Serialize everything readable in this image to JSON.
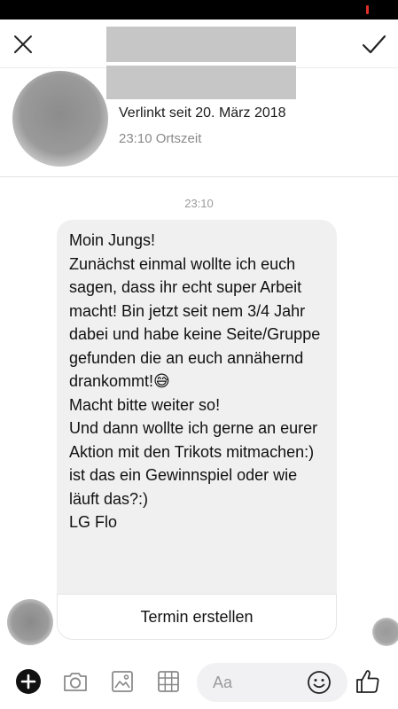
{
  "header": {
    "linked_text": "Verlinkt seit 20. März 2018",
    "local_time": "23:10 Ortszeit"
  },
  "conversation": {
    "timestamp": "23:10",
    "message": {
      "text": "Moin Jungs!\nZunächst einmal wollte ich euch sagen, dass ihr echt super Arbeit macht! Bin jetzt seit nem 3/4 Jahr dabei und habe keine Seite/Gruppe gefunden die an euch annähernd drankommt!😅\nMacht bitte weiter so!\nUnd dann wollte ich gerne an eurer Aktion mit den Trikots mitmachen:) ist das ein Gewinnspiel oder wie läuft das?:)\nLG Flo",
      "action_label": "Termin erstellen"
    }
  },
  "composer": {
    "placeholder": "Aa"
  },
  "icons": {
    "close": "close-icon",
    "confirm": "checkmark-icon",
    "plus": "plus-icon",
    "camera": "camera-icon",
    "image": "image-icon",
    "grid": "grid-icon",
    "emoji": "smiley-icon",
    "like": "thumbs-up-icon"
  },
  "colors": {
    "bubble": "#f0f0f0",
    "status_accent": "#e0302a",
    "placeholder_gray": "#9a9a9a"
  }
}
